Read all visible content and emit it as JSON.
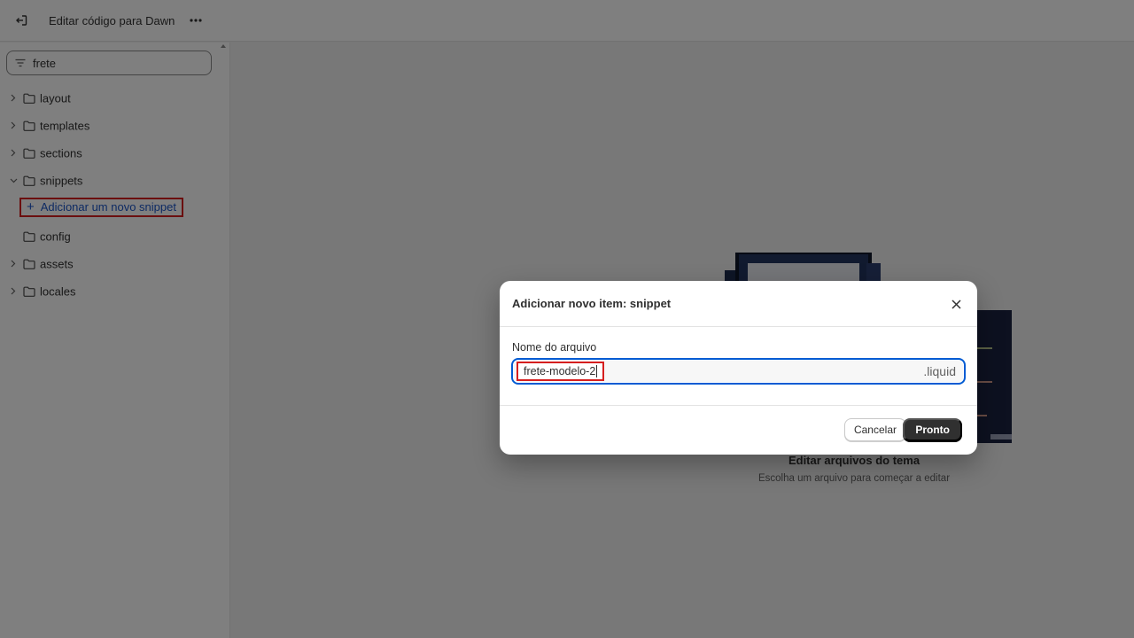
{
  "topbar": {
    "title": "Editar código para Dawn",
    "exit_icon": "exit-icon",
    "more_icon": "more-horizontal-icon"
  },
  "sidebar": {
    "search": {
      "value": "frete",
      "icon": "filter-icon"
    },
    "tree": [
      {
        "label": "layout",
        "expanded": false
      },
      {
        "label": "templates",
        "expanded": false
      },
      {
        "label": "sections",
        "expanded": false
      },
      {
        "label": "snippets",
        "expanded": true
      },
      {
        "label": "Adicionar um novo snippet",
        "type": "add-action"
      },
      {
        "label": "config",
        "expanded": null
      },
      {
        "label": "assets",
        "expanded": false
      },
      {
        "label": "locales",
        "expanded": false
      }
    ]
  },
  "main": {
    "empty_title": "Editar arquivos do tema",
    "empty_subtitle": "Escolha um arquivo para começar a editar"
  },
  "modal": {
    "title": "Adicionar novo item: snippet",
    "field_label": "Nome do arquivo",
    "field_value": "frete-modelo-2",
    "field_suffix": ".liquid",
    "cancel_label": "Cancelar",
    "done_label": "Pronto"
  },
  "colors": {
    "accent": "#005bd3",
    "link": "#1a54c6",
    "highlight": "#d61f1f",
    "primary_button": "#303030"
  }
}
